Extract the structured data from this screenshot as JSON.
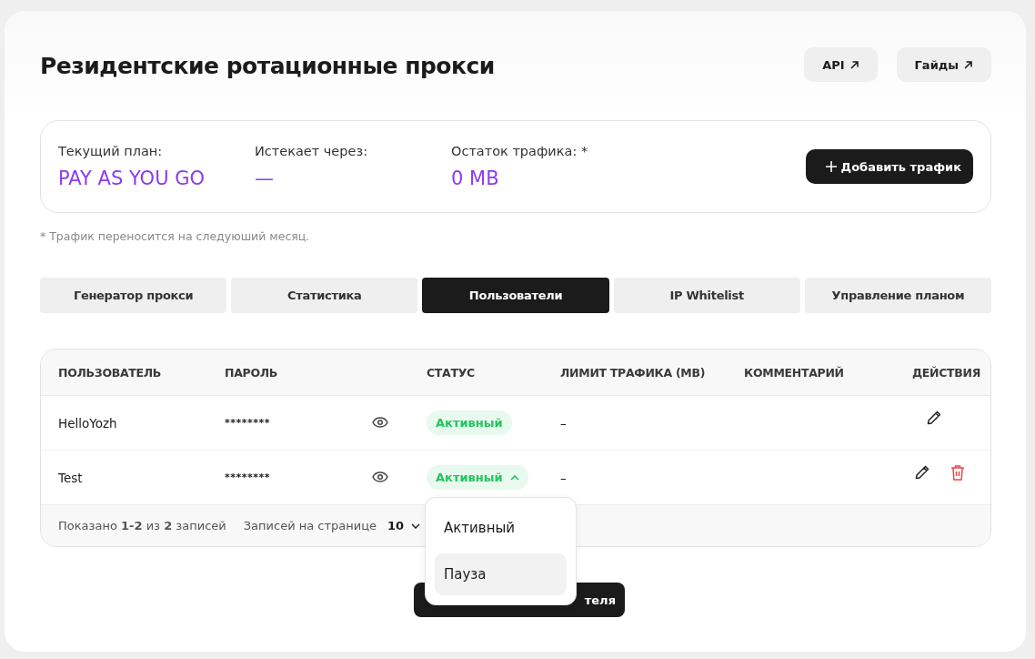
{
  "title": "Резидентские ротационные прокси",
  "header_links": [
    {
      "label": "API"
    },
    {
      "label": "Гайды"
    }
  ],
  "plan": {
    "items": [
      {
        "label": "Текущий план:",
        "value": "PAY AS YOU GO"
      },
      {
        "label": "Истекает через:",
        "value": "—"
      },
      {
        "label": "Остаток трафика: *",
        "value": "0 MB"
      }
    ],
    "button": "Добавить трафик"
  },
  "footnote": "* Трафик переносится на следуюший месяц.",
  "tabs": [
    {
      "label": "Генератор прокси",
      "selected": false
    },
    {
      "label": "Статистика",
      "selected": false
    },
    {
      "label": "Пользователи",
      "selected": true
    },
    {
      "label": "IP Whitelist",
      "selected": false
    },
    {
      "label": "Управление планом",
      "selected": false
    }
  ],
  "table": {
    "columns": [
      "ПОЛЬЗОВАТЕЛЬ",
      "ПАРОЛЬ",
      "СТАТУС",
      "ЛИМИТ ТРАФИКА (MB)",
      "КОММЕНТАРИЙ",
      "ДЕЙСТВИЯ"
    ],
    "rows": [
      {
        "user": "HelloYozh",
        "password": "********",
        "status": "Активный",
        "expanded": false,
        "limit": "–",
        "deletable": false
      },
      {
        "user": "Test",
        "password": "********",
        "status": "Активный",
        "expanded": true,
        "limit": "–",
        "deletable": true
      }
    ],
    "footer": {
      "summary": "Показано **1-2** из **2** записей",
      "per_page_label": "Записей на странице",
      "per_page": "10"
    }
  },
  "status_menu": [
    {
      "label": "Активный",
      "selected": false
    },
    {
      "label": "Пауза",
      "selected": true
    }
  ],
  "bottom_button": "теля"
}
